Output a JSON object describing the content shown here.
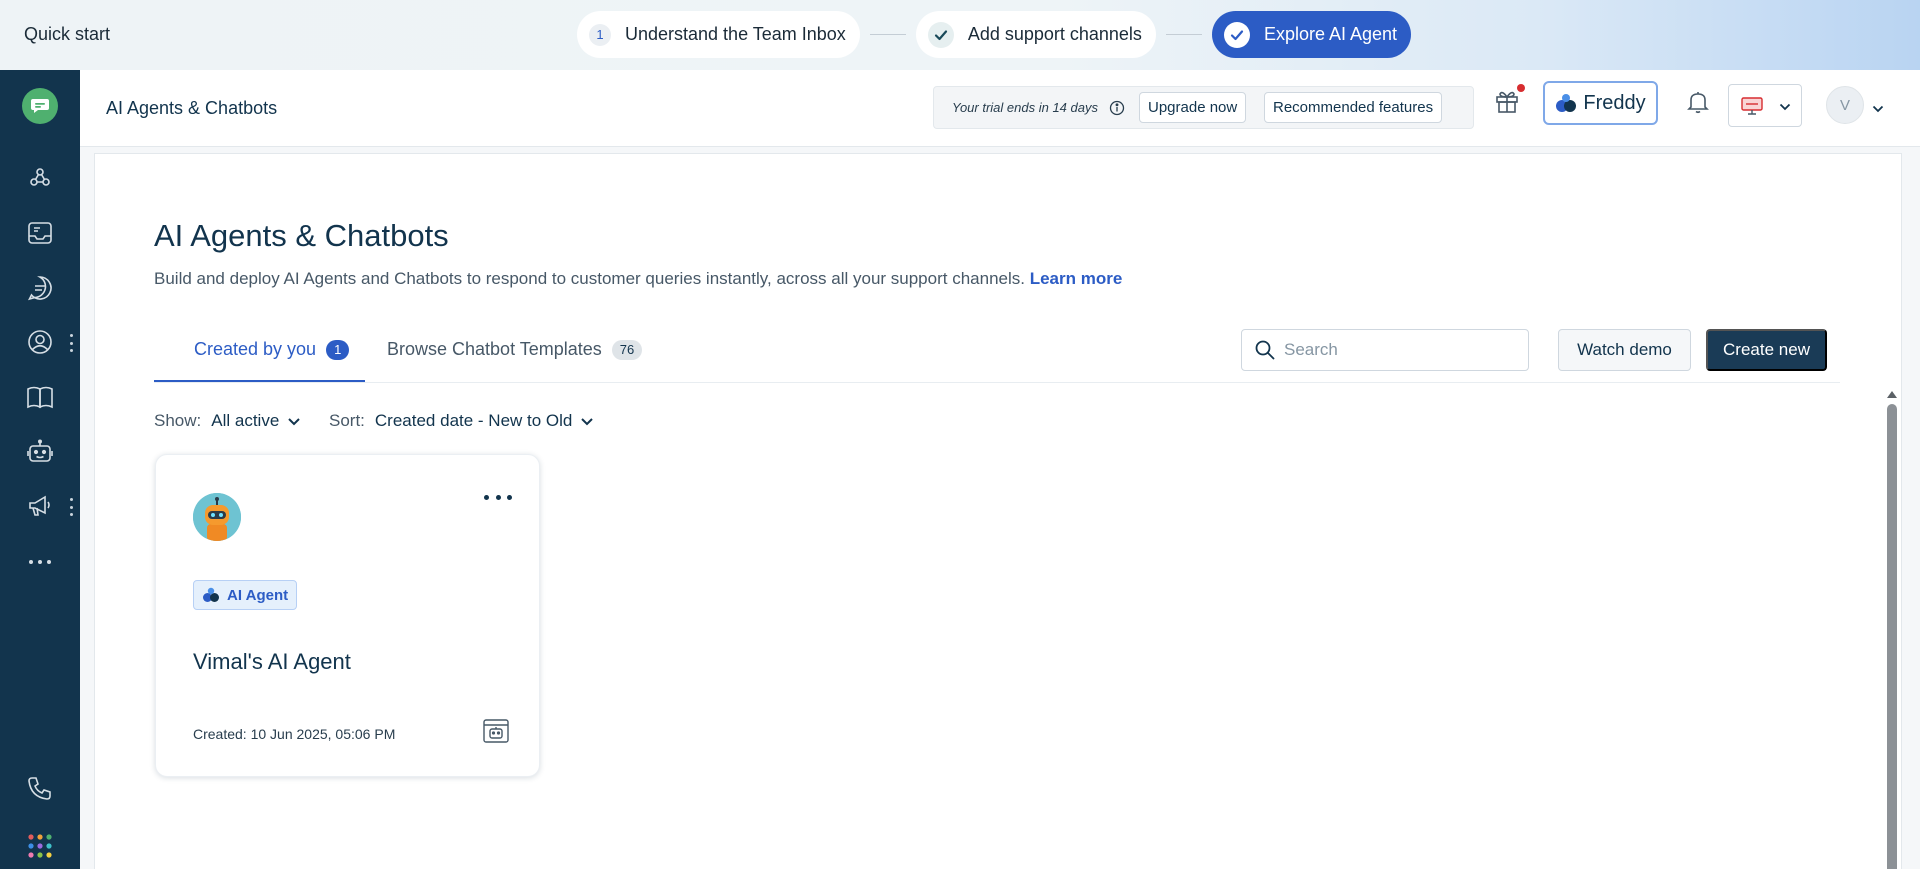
{
  "quick_start": {
    "title": "Quick start",
    "steps": [
      {
        "number": "1",
        "label": "Understand the Team Inbox",
        "state": "pending"
      },
      {
        "label": "Add support channels",
        "state": "done"
      },
      {
        "label": "Explore AI Agent",
        "state": "active"
      }
    ]
  },
  "sidebar": {
    "icons": [
      "app-logo-icon",
      "hub-icon",
      "inbox-icon",
      "conversations-icon",
      "contacts-icon",
      "knowledge-base-icon",
      "bot-icon",
      "campaigns-icon",
      "more-icon",
      "phone-icon",
      "apps-grid-icon"
    ]
  },
  "header": {
    "title": "AI Agents & Chatbots",
    "trial_text": "Your trial ends in 14 days",
    "upgrade_label": "Upgrade now",
    "recommended_label": "Recommended features",
    "freddy_label": "Freddy",
    "avatar_initial": "V"
  },
  "page": {
    "title": "AI Agents & Chatbots",
    "description": "Build and deploy AI Agents and Chatbots to respond to customer queries instantly, across all your support channels.",
    "learn_more": "Learn more",
    "tabs": [
      {
        "label": "Created by you",
        "count": "1",
        "active": true
      },
      {
        "label": "Browse Chatbot Templates",
        "count": "76",
        "active": false
      }
    ],
    "search_placeholder": "Search",
    "watch_demo_label": "Watch demo",
    "create_new_label": "Create new",
    "show_label": "Show:",
    "show_value": "All active",
    "sort_label": "Sort:",
    "sort_value": "Created date - New to Old"
  },
  "cards": [
    {
      "badge": "AI Agent",
      "name": "Vimal's AI Agent",
      "created": "Created: 10 Jun 2025, 05:06 PM"
    }
  ],
  "colors": {
    "sidebar": "#12344d",
    "accent": "#2c5cc5",
    "primary_button": "#1a3b56",
    "logo_green": "#4fb06f"
  }
}
